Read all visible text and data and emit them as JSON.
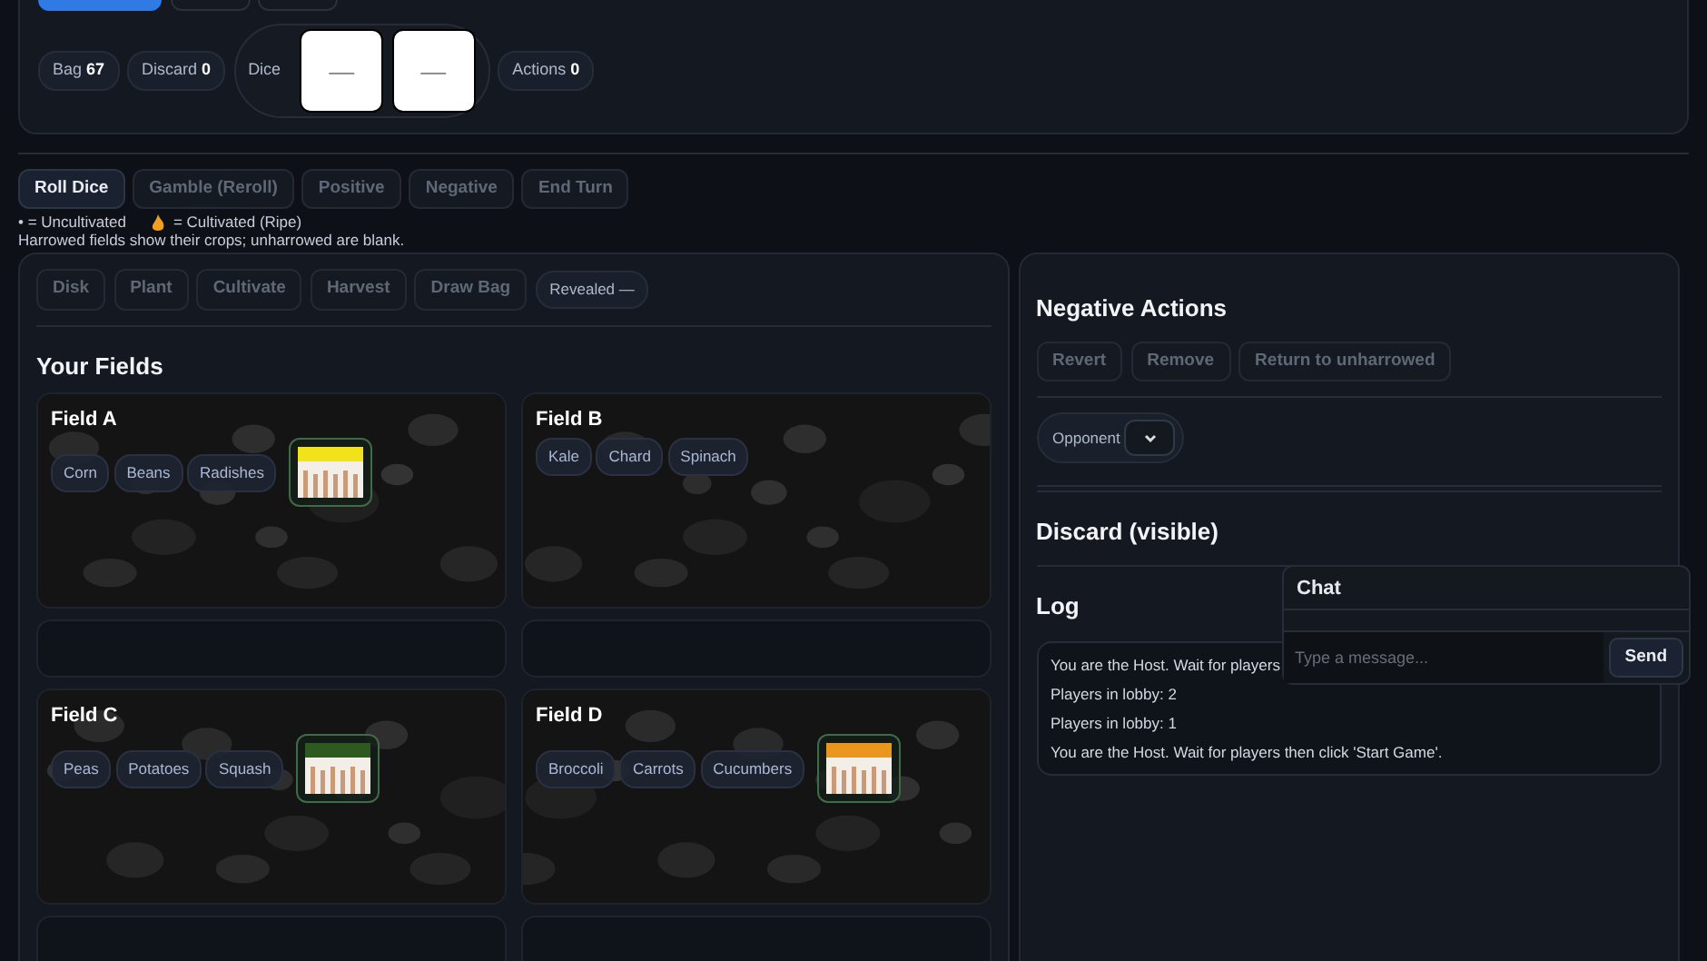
{
  "top_buttons": [
    {
      "kind": "primary"
    },
    {
      "kind": "secondary"
    },
    {
      "kind": "secondary"
    }
  ],
  "stats": [
    {
      "label": "Bag",
      "value": "67"
    },
    {
      "label": "Discard",
      "value": "0"
    }
  ],
  "dice": {
    "label": "Dice",
    "faces": [
      "—",
      "—"
    ]
  },
  "actions_stat": {
    "label": "Actions",
    "value": "0"
  },
  "turn_buttons": [
    {
      "label": "Roll Dice",
      "disabled": false
    },
    {
      "label": "Gamble (Reroll)",
      "disabled": true
    },
    {
      "label": "Positive",
      "disabled": true
    },
    {
      "label": "Negative",
      "disabled": true
    },
    {
      "label": "End Turn",
      "disabled": true
    }
  ],
  "legend": {
    "uncultivated": "• = Uncultivated",
    "cultivated": "= Cultivated (Ripe)",
    "note": "Harrowed fields show their crops; unharrowed are blank."
  },
  "field_actions": [
    {
      "label": "Disk",
      "disabled": true
    },
    {
      "label": "Plant",
      "disabled": true
    },
    {
      "label": "Cultivate",
      "disabled": true
    },
    {
      "label": "Harvest",
      "disabled": true
    },
    {
      "label": "Draw Bag",
      "disabled": true
    }
  ],
  "revealed": {
    "label": "Revealed",
    "value": "—"
  },
  "fields_title": "Your Fields",
  "fields": [
    {
      "name": "Field A",
      "crops": [
        "Corn",
        "Beans",
        "Radishes"
      ],
      "card": {
        "kind": "picture"
      }
    },
    {
      "name": "Field B",
      "crops": [
        "Kale",
        "Chard",
        "Spinach"
      ]
    },
    {
      "name": "Field C",
      "crops": [
        "Peas",
        "Potatoes",
        "Squash"
      ],
      "card": {
        "kind": "picture"
      }
    },
    {
      "name": "Field D",
      "crops": [
        "Broccoli",
        "Carrots",
        "Cucumbers"
      ],
      "card": {
        "kind": "picture"
      }
    }
  ],
  "negative": {
    "title": "Negative Actions",
    "buttons": [
      {
        "label": "Revert",
        "disabled": true
      },
      {
        "label": "Remove",
        "disabled": true
      },
      {
        "label": "Return to unharrowed",
        "disabled": true
      }
    ],
    "opponent_label": "Opponent"
  },
  "discard_title": "Discard (visible)",
  "log": {
    "title": "Log",
    "entries": [
      "You are the Host. Wait for players",
      "Players in lobby: 2",
      "Players in lobby: 1",
      "You are the Host. Wait for players then click 'Start Game'."
    ]
  },
  "chat": {
    "title": "Chat",
    "placeholder": "Type a message...",
    "send": "Send"
  }
}
